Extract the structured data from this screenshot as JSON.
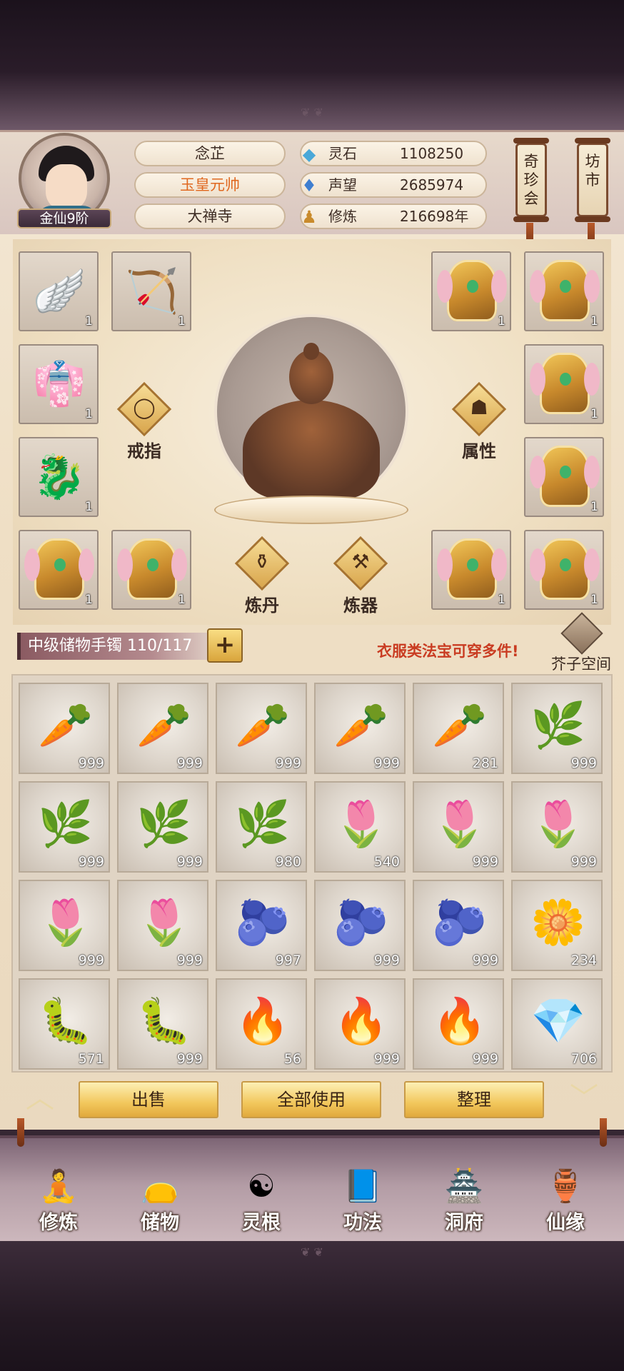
{
  "player": {
    "name": "念芷",
    "title": "玉皇元帅",
    "sect": "大禅寺",
    "rank": "金仙9阶"
  },
  "resources": [
    {
      "icon": "spirit-stone-icon",
      "label": "灵石",
      "value": "1108250"
    },
    {
      "icon": "reputation-icon",
      "label": "声望",
      "value": "2685974"
    },
    {
      "icon": "cultivation-icon",
      "label": "修炼",
      "value": "216698年"
    }
  ],
  "top_buttons": [
    {
      "label": "奇珍会"
    },
    {
      "label": "坊市"
    }
  ],
  "equipment": {
    "slots": [
      {
        "item": "wings",
        "count": "1"
      },
      {
        "item": "bow",
        "count": "1"
      },
      {
        "item": "red-robe",
        "count": "1"
      },
      {
        "item": "dragon-ring",
        "count": "1"
      },
      {
        "item": "golden-armor",
        "count": "1"
      },
      {
        "item": "golden-armor",
        "count": "1"
      },
      {
        "item": "golden-armor",
        "count": "1"
      },
      {
        "item": "golden-armor",
        "count": "1"
      },
      {
        "item": "golden-armor",
        "count": "1"
      },
      {
        "item": "golden-armor",
        "count": "1"
      },
      {
        "item": "golden-armor",
        "count": "1"
      },
      {
        "item": "golden-armor",
        "count": "1"
      }
    ],
    "ring_label": "戒指",
    "attr_label": "属性",
    "alchemy_label": "炼丹",
    "forge_label": "炼器"
  },
  "bag": {
    "name": "中级储物手镯 110/117",
    "hint": "衣服类法宝可穿多件!",
    "space_label": "芥子空间",
    "plus": "+"
  },
  "inventory": [
    {
      "item": "ginseng-root",
      "icon": "🥕",
      "count": "999"
    },
    {
      "item": "ginseng-root",
      "icon": "🥕",
      "count": "999"
    },
    {
      "item": "ginseng-root",
      "icon": "🥕",
      "count": "999"
    },
    {
      "item": "ginseng-root",
      "icon": "🥕",
      "count": "999"
    },
    {
      "item": "ginseng-root",
      "icon": "🥕",
      "count": "281"
    },
    {
      "item": "leaf-tuber",
      "icon": "🌿",
      "count": "999"
    },
    {
      "item": "leaf-tuber",
      "icon": "🌿",
      "count": "999"
    },
    {
      "item": "leaf-tuber",
      "icon": "🌿",
      "count": "999"
    },
    {
      "item": "leaf-tuber",
      "icon": "🌿",
      "count": "980"
    },
    {
      "item": "flower-herb",
      "icon": "🌷",
      "count": "540"
    },
    {
      "item": "flower-herb",
      "icon": "🌷",
      "count": "999"
    },
    {
      "item": "flower-herb",
      "icon": "🌷",
      "count": "999"
    },
    {
      "item": "flower-herb",
      "icon": "🌷",
      "count": "999"
    },
    {
      "item": "flower-herb",
      "icon": "🌷",
      "count": "999"
    },
    {
      "item": "berry-branch",
      "icon": "🫐",
      "count": "997"
    },
    {
      "item": "berry-branch",
      "icon": "🫐",
      "count": "999"
    },
    {
      "item": "berry-branch",
      "icon": "🫐",
      "count": "999"
    },
    {
      "item": "daisy-flower",
      "icon": "🌼",
      "count": "234"
    },
    {
      "item": "caterpillar-fungus",
      "icon": "🐛",
      "count": "571"
    },
    {
      "item": "caterpillar-fungus",
      "icon": "🐛",
      "count": "999"
    },
    {
      "item": "fire-ore",
      "icon": "🔥",
      "count": "56"
    },
    {
      "item": "fire-ore",
      "icon": "🔥",
      "count": "999"
    },
    {
      "item": "fire-ore",
      "icon": "🔥",
      "count": "999"
    },
    {
      "item": "blue-crystal",
      "icon": "💎",
      "count": "706"
    }
  ],
  "actions": {
    "sell": "出售",
    "use_all": "全部使用",
    "sort": "整理"
  },
  "nav": [
    {
      "label": "修炼",
      "icon": "🧘"
    },
    {
      "label": "储物",
      "icon": "👝"
    },
    {
      "label": "灵根",
      "icon": "☯"
    },
    {
      "label": "功法",
      "icon": "📘"
    },
    {
      "label": "洞府",
      "icon": "🏯"
    },
    {
      "label": "仙缘",
      "icon": "🏺"
    }
  ],
  "colors": {
    "accent_title": "#e0681f",
    "hint_red": "#c93c22",
    "gold_button": "#f2c75c"
  }
}
